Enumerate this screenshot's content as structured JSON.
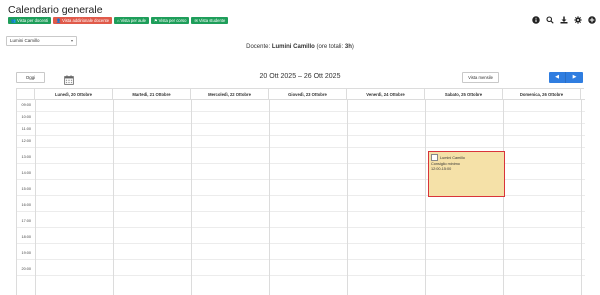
{
  "page": {
    "title": "Calendario generale"
  },
  "view_buttons": [
    {
      "label": "Vista per docenti",
      "color": "#1e9e5a",
      "icon": "users-icon"
    },
    {
      "label": "Vista addirionale docente",
      "color": "#e05a4a",
      "icon": "user-icon"
    },
    {
      "label": "Vista per aule",
      "color": "#1e9e5a",
      "icon": "home-icon"
    },
    {
      "label": "Vista per corso",
      "color": "#1e9e5a",
      "icon": "sitemap-icon"
    },
    {
      "label": "Vista studente",
      "color": "#1e9e5a",
      "icon": "chat-icon"
    }
  ],
  "top_icons": [
    "info-icon",
    "search-icon",
    "download-icon",
    "gear-icon",
    "plus-circle-icon"
  ],
  "teacher_select": {
    "value": "Lumini Camillo"
  },
  "docente_line": {
    "prefix": "Docente:",
    "name": "Lumini Camillo",
    "total_prefix": "(ore totali:",
    "total_value": "3h",
    "total_suffix": ")"
  },
  "toolbar": {
    "today_label": "Oggi",
    "range_title": "20 Ott 2025 – 26 Ott 2025",
    "month_view_label": "Vista mensile",
    "prev_label": "◀",
    "next_label": "▶"
  },
  "days": [
    "Lunedì, 20 Ottobre",
    "Martedì, 21 Ottobre",
    "Mercoledì, 22 Ottobre",
    "Giovedì, 23 Ottobre",
    "Venerdì, 24 Ottobre",
    "Sabato, 25 Ottobre",
    "Domenica, 26 Ottobre"
  ],
  "hours": [
    "09:00",
    "10:00",
    "11:00",
    "12:00",
    "13:00",
    "14:00",
    "15:00",
    "16:00",
    "17:00",
    "18:00",
    "19:00",
    "20:00"
  ],
  "event": {
    "teacher": "Lumini Camillo",
    "title": "Consiglio minimo",
    "time": "12:00-15:00",
    "day": "Sabato, 25 Ottobre",
    "background": "#f5e1a8",
    "border": "#d9343a"
  }
}
